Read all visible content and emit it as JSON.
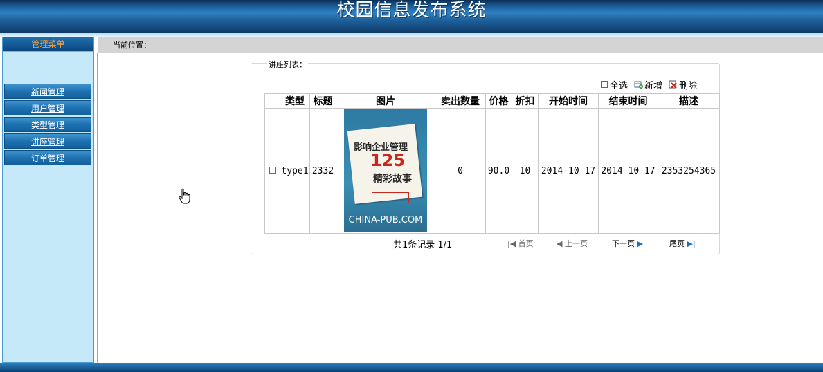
{
  "header": {
    "title": "校园信息发布系统"
  },
  "sidebar": {
    "title": "管理菜单",
    "items": [
      {
        "label": "新闻管理"
      },
      {
        "label": "用户管理"
      },
      {
        "label": "类型管理"
      },
      {
        "label": "讲座管理"
      },
      {
        "label": "订单管理"
      }
    ]
  },
  "breadcrumb": {
    "label": "当前位置："
  },
  "panel": {
    "legend": "讲座列表："
  },
  "toolbar": {
    "select_all": "全选",
    "add": "新增",
    "delete": "删除"
  },
  "table": {
    "headers": [
      "类型",
      "标题",
      "图片",
      "卖出数量",
      "价格",
      "折扣",
      "开始时间",
      "结束时间",
      "描述"
    ],
    "rows": [
      {
        "type": "type1",
        "title": "2332",
        "image": {
          "cover_line1": "影响企业管理",
          "cover_line2": "125",
          "cover_line3": "精彩故事",
          "brand": "CHINA-PUB.COM"
        },
        "sold": "0",
        "price": "90.0",
        "discount": "10",
        "start": "2014-10-17",
        "end": "2014-10-17",
        "description": "2353254365"
      }
    ]
  },
  "pager": {
    "summary": "共1条记录 1/1",
    "first": "首页",
    "prev": "上一页",
    "next": "下一页",
    "last": "尾页"
  },
  "colors": {
    "header_blue": "#1e5f99",
    "sidebar_bg": "#c5e9f9",
    "menu_title_text": "#f0a040",
    "breadcrumb_bg": "#d4d4d4"
  },
  "icons": {
    "add": "add-record-icon",
    "delete": "delete-icon",
    "first": "first-page-icon",
    "prev": "prev-page-icon",
    "next": "next-page-icon",
    "last": "last-page-icon",
    "cursor": "hand-cursor-icon"
  }
}
